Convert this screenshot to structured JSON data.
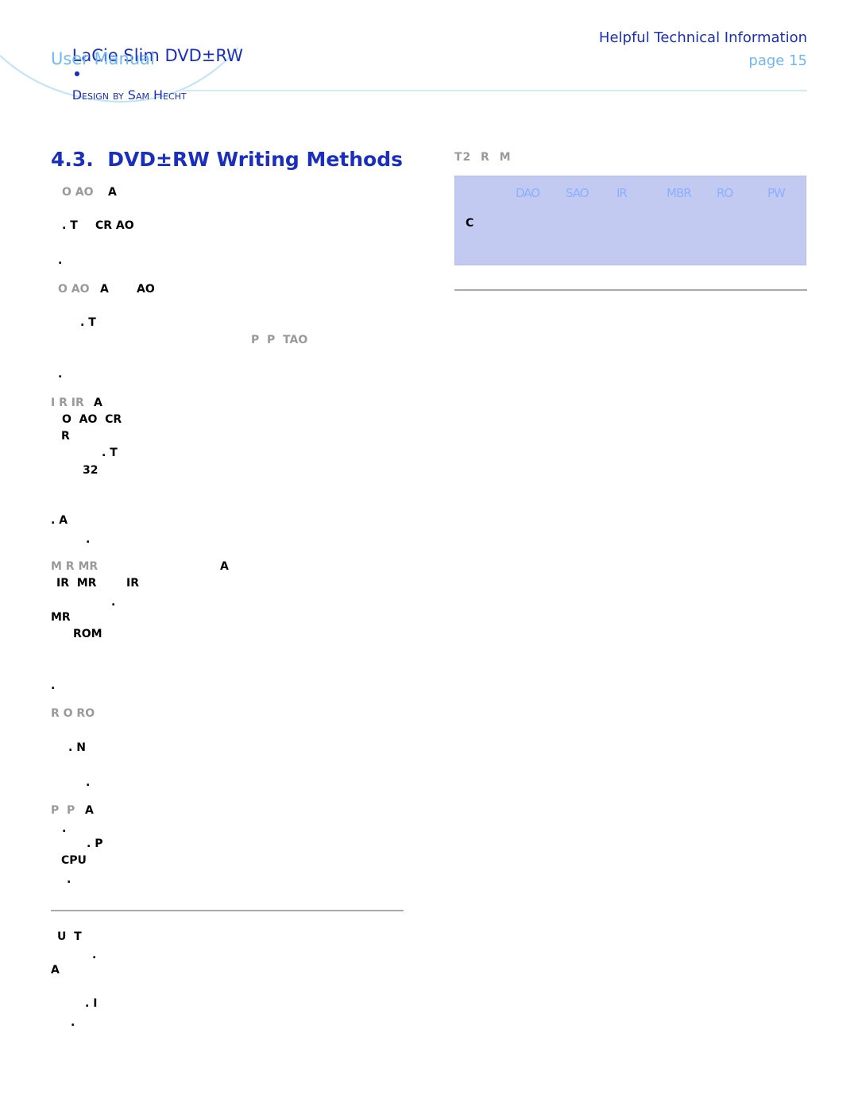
{
  "header": {
    "product": "LaCie Slim DVD±RW",
    "bullet": "•",
    "design_credit": "Design by Sam Hecht",
    "subtitle": "User Manual",
    "section": "Helpful Technical Information",
    "page": "page 15"
  },
  "section_title": "4.3.  DVD±RW Writing Methods",
  "left_fragments": [
    "O AO",
    "A",
    ". T",
    "CR AO",
    ".",
    "O AO",
    "A",
    "AO",
    ". T",
    "P  P  TAO",
    ".",
    "I R IR",
    "A",
    "O  AO  CR",
    "R",
    ". T",
    "32",
    ". A",
    ".",
    "M R MR",
    "A",
    "IR  MR",
    "IR",
    ".",
    "MR",
    "ROM",
    ".",
    "R O RO",
    ". N",
    ".",
    "P  P",
    "A",
    ".",
    ". P",
    "CPU",
    ".",
    "U  T",
    ".",
    "A",
    ". I",
    "."
  ],
  "table": {
    "title": "T2  R  M",
    "columns": [
      "DAO",
      "SAO",
      "IR",
      "MBR",
      "RO",
      "PW"
    ],
    "row_label": "C"
  },
  "colors": {
    "title_blue": "#1a2fbf",
    "light_blue": "#6fb8f5",
    "table_bg": "#c3caf2"
  }
}
